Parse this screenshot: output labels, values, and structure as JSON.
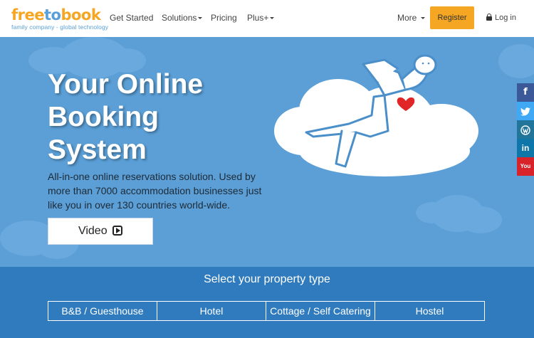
{
  "nav": {
    "logo_part1": "free",
    "logo_part2": "to",
    "logo_part3": "book",
    "logo_tagline": "family company - global technology",
    "links": [
      "Get Started",
      "Solutions",
      "Pricing",
      "Plus+",
      "More"
    ],
    "register_label": "Register",
    "login_label": "Log in"
  },
  "hero": {
    "title_line1": "Your Online",
    "title_line2": "Booking",
    "title_line3": "System",
    "subtitle": "All-in-one online reservations solution. Used by more than 7000 accommodation businesses just like you in over 130 countries world-wide.",
    "video_label": "Video"
  },
  "social": {
    "items": [
      {
        "name": "facebook",
        "glyph": "f",
        "color": "#3b5998"
      },
      {
        "name": "twitter",
        "glyph": "t",
        "color": "#3fa9f5"
      },
      {
        "name": "wordpress",
        "glyph": "W",
        "color": "#21759b"
      },
      {
        "name": "linkedin",
        "glyph": "in",
        "color": "#0e76a8"
      },
      {
        "name": "youtube",
        "glyph": "You",
        "color": "#d9232a"
      }
    ]
  },
  "property": {
    "title": "Select your property type",
    "types": [
      "B&B / Guesthouse",
      "Hotel",
      "Cottage / Self Catering",
      "Hostel"
    ]
  },
  "colors": {
    "accent_orange": "#f5a623",
    "sky_blue": "#5b9fd6",
    "band_blue": "#2f7bbd"
  }
}
